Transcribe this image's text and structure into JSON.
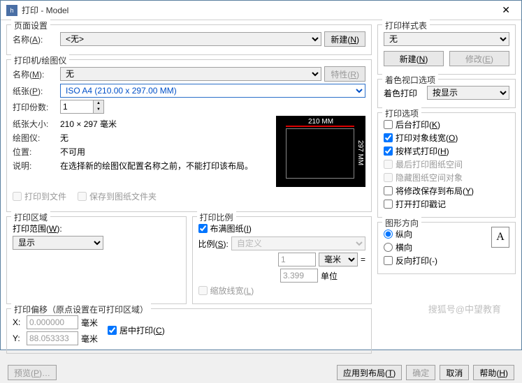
{
  "title": "打印 - Model",
  "pageSetup": {
    "legend": "页面设置",
    "nameLbl": "名称(A):",
    "nameVal": "<无>",
    "newBtn": "新建(N)"
  },
  "printer": {
    "legend": "打印机/绘图仪",
    "nameLbl": "名称(M):",
    "nameVal": "无",
    "propsBtn": "特性(R)",
    "paperLbl": "纸张(P):",
    "paperVal": "ISO A4 (210.00 x 297.00 MM)",
    "copiesLbl": "打印份数:",
    "copiesVal": "1",
    "sizeLbl": "纸张大小:",
    "sizeVal": "210 × 297   毫米",
    "plotterLbl": "绘图仪:",
    "plotterVal": "无",
    "locLbl": "位置:",
    "locVal": "不可用",
    "descLbl": "说明:",
    "descVal": "在选择新的绘图仪配置名称之前，不能打印该布局。",
    "toFile": "打印到文件",
    "saveFolder": "保存到图纸文件夹",
    "pvW": "210 MM",
    "pvH": "297 MM"
  },
  "area": {
    "legend": "打印区域",
    "rangeLbl": "打印范围(W):",
    "rangeVal": "显示"
  },
  "scale": {
    "legend": "打印比例",
    "fit": "布满图纸(I)",
    "ratioLbl": "比例(S):",
    "ratioVal": "自定义",
    "numVal": "1",
    "unitSel": "毫米",
    "eq": "=",
    "denomVal": "3.399",
    "unitLbl": "单位",
    "scaleLw": "缩放线宽(L)"
  },
  "offset": {
    "legend": "打印偏移（原点设置在可打印区域）",
    "xLbl": "X:",
    "xVal": "0.000000",
    "yLbl": "Y:",
    "yVal": "88.053333",
    "mm": "毫米",
    "center": "居中打印(C)"
  },
  "styleTable": {
    "legend": "打印样式表",
    "val": "无",
    "newBtn": "新建(N)",
    "editBtn": "修改(E)"
  },
  "shade": {
    "legend": "着色视口选项",
    "lbl": "着色打印",
    "val": "按显示"
  },
  "options": {
    "legend": "打印选项",
    "bg": "后台打印(K)",
    "lw": "打印对象线宽(O)",
    "style": "按样式打印(H)",
    "lastSpace": "最后打印图纸空间",
    "hideSpace": "隐藏图纸空间对象",
    "saveLayout": "将修改保存到布局(Y)",
    "stamp": "打开打印戳记"
  },
  "orient": {
    "legend": "图形方向",
    "portrait": "纵向",
    "landscape": "横向",
    "reverse": "反向打印(-)",
    "icon": "A"
  },
  "footer": {
    "preview": "预览(P)…",
    "apply": "应用到布局(T)",
    "ok": "确定",
    "cancel": "取消",
    "help": "帮助(H)"
  },
  "watermark": "搜狐号@中望教育"
}
